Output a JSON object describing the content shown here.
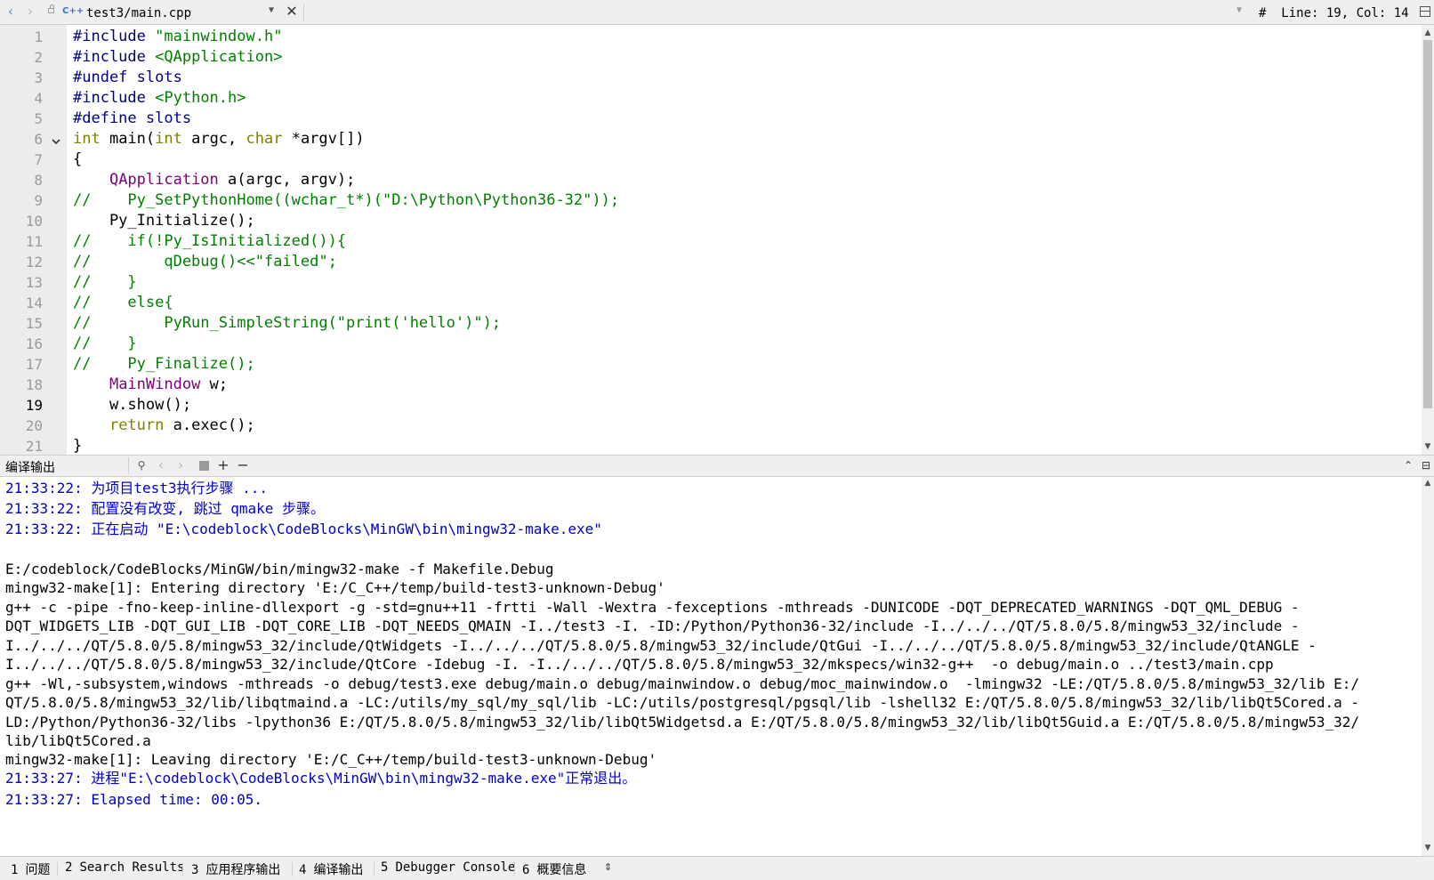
{
  "toolbar": {
    "back_icon": "‹",
    "forward_icon": "›",
    "file_type_icon": "C++",
    "file_name": "test3/main.cpp",
    "cursor_position": "#  Line: 19, Col: 14"
  },
  "editor": {
    "line_numbers": [
      "1",
      "2",
      "3",
      "4",
      "5",
      "6",
      "7",
      "8",
      "9",
      "10",
      "11",
      "12",
      "13",
      "14",
      "15",
      "16",
      "17",
      "18",
      "19",
      "20",
      "21"
    ],
    "current_line": "19"
  },
  "output_pane": {
    "title": "编译输出",
    "lines": [
      "21:33:22: 为项目test3执行步骤 ...",
      "21:33:22: 配置没有改变, 跳过 qmake 步骤。",
      "21:33:22: 正在启动 \"E:\\codeblock\\CodeBlocks\\MinGW\\bin\\mingw32-make.exe\"",
      "",
      "E:/codeblock/CodeBlocks/MinGW/bin/mingw32-make -f Makefile.Debug",
      "mingw32-make[1]: Entering directory 'E:/C_C++/temp/build-test3-unknown-Debug'",
      "g++ -c -pipe -fno-keep-inline-dllexport -g -std=gnu++11 -frtti -Wall -Wextra -fexceptions -mthreads -DUNICODE -DQT_DEPRECATED_WARNINGS -DQT_QML_DEBUG -",
      "DQT_WIDGETS_LIB -DQT_GUI_LIB -DQT_CORE_LIB -DQT_NEEDS_QMAIN -I../test3 -I. -ID:/Python/Python36-32/include -I../../../QT/5.8.0/5.8/mingw53_32/include -",
      "I../../../QT/5.8.0/5.8/mingw53_32/include/QtWidgets -I../../../QT/5.8.0/5.8/mingw53_32/include/QtGui -I../../../QT/5.8.0/5.8/mingw53_32/include/QtANGLE -",
      "I../../../QT/5.8.0/5.8/mingw53_32/include/QtCore -Idebug -I. -I../../../QT/5.8.0/5.8/mingw53_32/mkspecs/win32-g++  -o debug/main.o ../test3/main.cpp",
      "g++ -Wl,-subsystem,windows -mthreads -o debug/test3.exe debug/main.o debug/mainwindow.o debug/moc_mainwindow.o  -lmingw32 -LE:/QT/5.8.0/5.8/mingw53_32/lib E:/",
      "QT/5.8.0/5.8/mingw53_32/lib/libqtmaind.a -LC:/utils/my_sql/my_sql/lib -LC:/utils/postgresql/pgsql/lib -lshell32 E:/QT/5.8.0/5.8/mingw53_32/lib/libQt5Cored.a -",
      "LD:/Python/Python36-32/libs -lpython36 E:/QT/5.8.0/5.8/mingw53_32/lib/libQt5Widgetsd.a E:/QT/5.8.0/5.8/mingw53_32/lib/libQt5Guid.a E:/QT/5.8.0/5.8/mingw53_32/",
      "lib/libQt5Cored.a",
      "mingw32-make[1]: Leaving directory 'E:/C_C++/temp/build-test3-unknown-Debug'",
      "21:33:27: 进程\"E:\\codeblock\\CodeBlocks\\MinGW\\bin\\mingw32-make.exe\"正常退出。",
      "21:33:27: Elapsed time: 00:05."
    ],
    "line_colors": [
      "blue",
      "blue",
      "blue",
      "black",
      "black",
      "black",
      "black",
      "black",
      "black",
      "black",
      "black",
      "black",
      "black",
      "black",
      "black",
      "blue",
      "blue"
    ]
  },
  "status_tabs": [
    {
      "num": "1",
      "label": "问题"
    },
    {
      "num": "2",
      "label": "Search Results"
    },
    {
      "num": "3",
      "label": "应用程序输出"
    },
    {
      "num": "4",
      "label": "编译输出"
    },
    {
      "num": "5",
      "label": "Debugger Console"
    },
    {
      "num": "6",
      "label": "概要信息"
    }
  ]
}
